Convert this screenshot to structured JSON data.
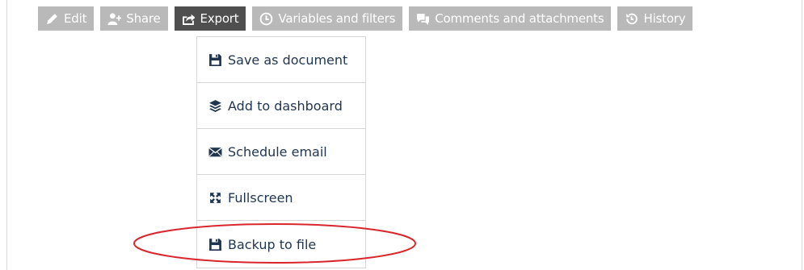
{
  "toolbar": {
    "edit_label": "Edit",
    "share_label": "Share",
    "export_label": "Export",
    "variables_label": "Variables and filters",
    "comments_label": "Comments and attachments",
    "history_label": "History",
    "button_color": "#b9b9b9",
    "active_color": "#4f4f4f"
  },
  "export_menu": {
    "items": [
      {
        "label": "Save as document",
        "icon": "floppy-disk-icon"
      },
      {
        "label": "Add to dashboard",
        "icon": "layers-icon"
      },
      {
        "label": "Schedule email",
        "icon": "envelope-icon"
      },
      {
        "label": "Fullscreen",
        "icon": "fullscreen-icon"
      },
      {
        "label": "Backup to file",
        "icon": "floppy-disk-icon"
      }
    ],
    "text_color": "#1f3550"
  },
  "annotation": {
    "color": "#d9262c"
  }
}
